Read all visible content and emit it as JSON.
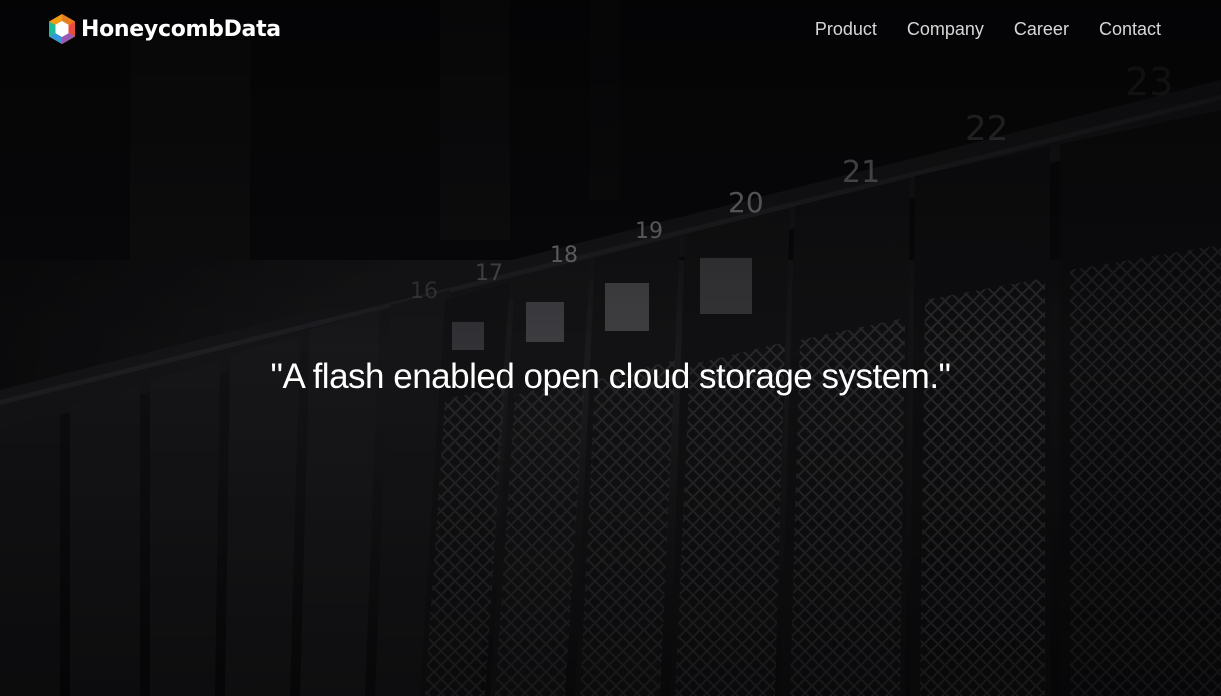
{
  "brand": {
    "name": "HoneycombData",
    "colors": [
      "#F39C12",
      "#E74C3C",
      "#3498DB",
      "#9B59B6"
    ]
  },
  "nav": {
    "items": [
      {
        "label": "Product"
      },
      {
        "label": "Company"
      },
      {
        "label": "Career"
      },
      {
        "label": "Contact"
      }
    ]
  },
  "hero": {
    "tagline": "\"A flash enabled open cloud storage system.\"",
    "background": "server-rack-photo",
    "bay_numbers": [
      "16",
      "17",
      "18",
      "19",
      "20",
      "21",
      "22",
      "23"
    ]
  }
}
